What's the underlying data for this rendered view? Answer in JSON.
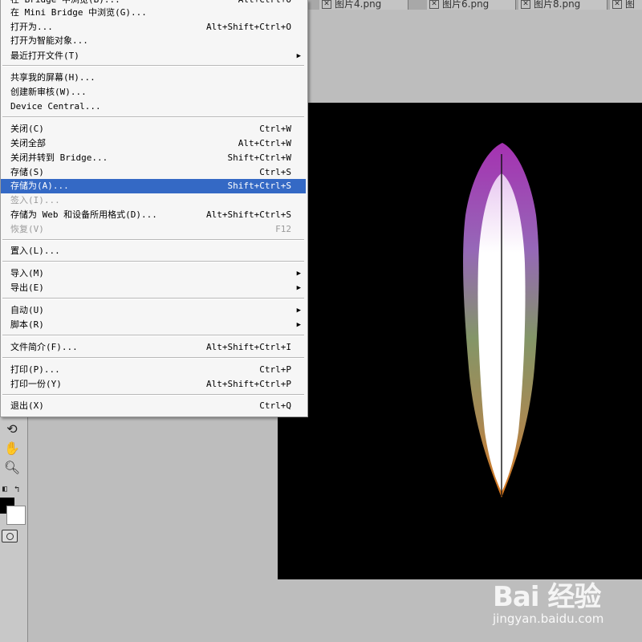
{
  "tabs": [
    {
      "label": "图片4.png"
    },
    {
      "label": "图片6.png"
    },
    {
      "label": "图片8.png"
    },
    {
      "label": "图"
    }
  ],
  "file_menu": {
    "items": [
      {
        "label": "在 Bridge 中浏览(B)...",
        "shortcut": "Alt+Ctrl+O",
        "submenu": false,
        "disabled": false,
        "selected": false
      },
      {
        "label": "在 Mini Bridge 中浏览(G)...",
        "shortcut": "",
        "submenu": false,
        "disabled": false,
        "selected": false
      },
      {
        "label": "打开为...",
        "shortcut": "Alt+Shift+Ctrl+O",
        "submenu": false,
        "disabled": false,
        "selected": false
      },
      {
        "label": "打开为智能对象...",
        "shortcut": "",
        "submenu": false,
        "disabled": false,
        "selected": false
      },
      {
        "label": "最近打开文件(T)",
        "shortcut": "",
        "submenu": true,
        "disabled": false,
        "selected": false
      },
      {
        "label": "共享我的屏幕(H)...",
        "shortcut": "",
        "submenu": false,
        "disabled": false,
        "selected": false
      },
      {
        "label": "创建新审核(W)...",
        "shortcut": "",
        "submenu": false,
        "disabled": false,
        "selected": false
      },
      {
        "label": "Device Central...",
        "shortcut": "",
        "submenu": false,
        "disabled": false,
        "selected": false
      },
      {
        "label": "关闭(C)",
        "shortcut": "Ctrl+W",
        "submenu": false,
        "disabled": false,
        "selected": false
      },
      {
        "label": "关闭全部",
        "shortcut": "Alt+Ctrl+W",
        "submenu": false,
        "disabled": false,
        "selected": false
      },
      {
        "label": "关闭并转到 Bridge...",
        "shortcut": "Shift+Ctrl+W",
        "submenu": false,
        "disabled": false,
        "selected": false
      },
      {
        "label": "存储(S)",
        "shortcut": "Ctrl+S",
        "submenu": false,
        "disabled": false,
        "selected": false
      },
      {
        "label": "存储为(A)...",
        "shortcut": "Shift+Ctrl+S",
        "submenu": false,
        "disabled": false,
        "selected": true
      },
      {
        "label": "签入(I)...",
        "shortcut": "",
        "submenu": false,
        "disabled": true,
        "selected": false
      },
      {
        "label": "存储为 Web 和设备所用格式(D)...",
        "shortcut": "Alt+Shift+Ctrl+S",
        "submenu": false,
        "disabled": false,
        "selected": false
      },
      {
        "label": "恢复(V)",
        "shortcut": "F12",
        "submenu": false,
        "disabled": true,
        "selected": false
      },
      {
        "label": "置入(L)...",
        "shortcut": "",
        "submenu": false,
        "disabled": false,
        "selected": false
      },
      {
        "label": "导入(M)",
        "shortcut": "",
        "submenu": true,
        "disabled": false,
        "selected": false
      },
      {
        "label": "导出(E)",
        "shortcut": "",
        "submenu": true,
        "disabled": false,
        "selected": false
      },
      {
        "label": "自动(U)",
        "shortcut": "",
        "submenu": true,
        "disabled": false,
        "selected": false
      },
      {
        "label": "脚本(R)",
        "shortcut": "",
        "submenu": true,
        "disabled": false,
        "selected": false
      },
      {
        "label": "文件简介(F)...",
        "shortcut": "Alt+Shift+Ctrl+I",
        "submenu": false,
        "disabled": false,
        "selected": false
      },
      {
        "label": "打印(P)...",
        "shortcut": "Ctrl+P",
        "submenu": false,
        "disabled": false,
        "selected": false
      },
      {
        "label": "打印一份(Y)",
        "shortcut": "Alt+Shift+Ctrl+P",
        "submenu": false,
        "disabled": false,
        "selected": false
      },
      {
        "label": "退出(X)",
        "shortcut": "Ctrl+Q",
        "submenu": false,
        "disabled": false,
        "selected": false
      }
    ],
    "selected_color": "#3469c5"
  },
  "toolbox": {
    "tools": [
      {
        "name": "rotate-view-tool-icon"
      },
      {
        "name": "hand-tool-icon"
      },
      {
        "name": "zoom-tool-icon"
      },
      {
        "name": "default-colors-icon"
      },
      {
        "name": "swap-colors-icon"
      },
      {
        "name": "quick-mask-icon"
      }
    ],
    "foreground_color": "#000000",
    "background_color": "#ffffff"
  },
  "document": {
    "background_color": "#000000"
  },
  "watermark": {
    "logo": "Bai 经验",
    "url": "jingyan.baidu.com"
  }
}
